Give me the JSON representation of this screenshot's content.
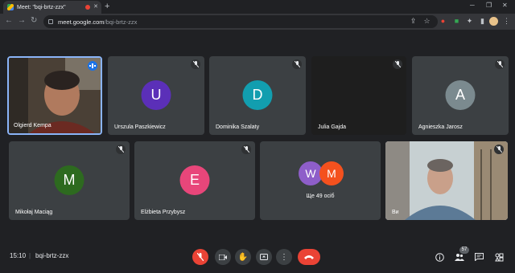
{
  "browser": {
    "tab_title": "Meet: \"bqi-brtz-zzx\"",
    "new_tab": "+",
    "url_host": "meet.google.com",
    "url_path": "/bqi-brtz-zzx"
  },
  "participants_row1": [
    {
      "name": "Olgierd Kempa",
      "type": "video",
      "speaking": true
    },
    {
      "name": "Urszula Paszkiewicz",
      "initial": "U",
      "color": "#5b2fb8",
      "muted": true
    },
    {
      "name": "Dominika Szalaty",
      "initial": "D",
      "color": "#129eaf",
      "muted": true
    },
    {
      "name": "Julia Gajda",
      "type": "dark",
      "muted": true
    },
    {
      "name": "Agnieszka Jarosz",
      "initial": "A",
      "color": "#7b8a8f",
      "muted": true
    }
  ],
  "participants_row2": [
    {
      "name": "Mikołaj Maciąg",
      "initial": "M",
      "color": "#2d6a1f",
      "muted": true
    },
    {
      "name": "Elżbieta Przybysz",
      "initial": "E",
      "color": "#e8467a",
      "muted": true
    },
    {
      "name": "Ви",
      "type": "video",
      "muted": true
    }
  ],
  "more_tile": {
    "label": "Ще 49 осіб",
    "avatars": [
      {
        "initial": "W",
        "color": "#8e5ec9"
      },
      {
        "initial": "M",
        "color": "#f4511e"
      }
    ]
  },
  "bottom": {
    "time": "15:10",
    "separator": "|",
    "meeting_code": "bqi-brtz-zzx",
    "participant_count": "57"
  },
  "colors": {
    "accent_red": "#ea4335",
    "tile_bg": "#3c4043",
    "speaking_border": "#8ab4f8"
  }
}
